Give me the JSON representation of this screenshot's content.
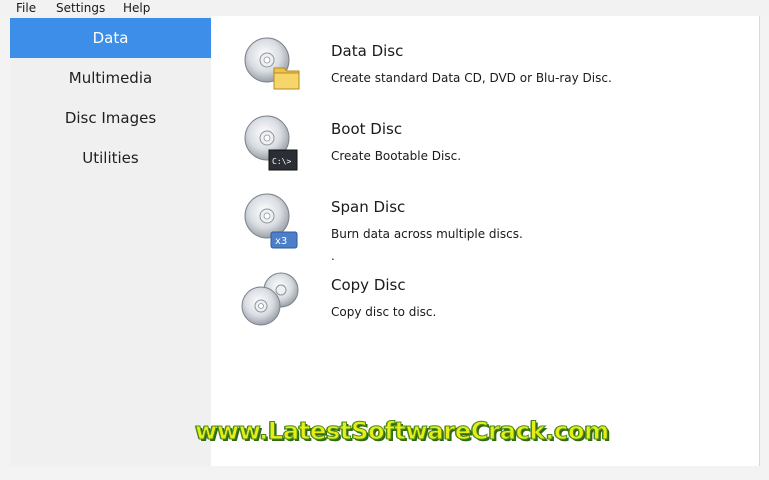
{
  "menu": [
    "File",
    "Settings",
    "Help"
  ],
  "sidebar": {
    "items": [
      {
        "label": "Data",
        "active": true
      },
      {
        "label": "Multimedia",
        "active": false
      },
      {
        "label": "Disc Images",
        "active": false
      },
      {
        "label": "Utilities",
        "active": false
      }
    ]
  },
  "options": [
    {
      "title": "Data Disc",
      "description": "Create standard Data CD, DVD or Blu-ray Disc.",
      "icon": "data-disc-icon"
    },
    {
      "title": "Boot Disc",
      "description": "Create Bootable Disc.",
      "icon": "boot-disc-icon",
      "badge": "C:\\>"
    },
    {
      "title": "Span Disc",
      "description": "Burn data across multiple discs.",
      "icon": "span-disc-icon",
      "badge": "x3"
    },
    {
      "title": "Copy Disc",
      "description": "Copy disc to disc.",
      "icon": "copy-disc-icon"
    }
  ],
  "stray_text": ".",
  "watermark": "www.LatestSoftwareCrack.com",
  "colors": {
    "accent": "#3d8ee8",
    "sidebar_bg": "#f0f0f0",
    "watermark_fill": "#e8ee13",
    "watermark_outline": "#4b8a1d"
  }
}
